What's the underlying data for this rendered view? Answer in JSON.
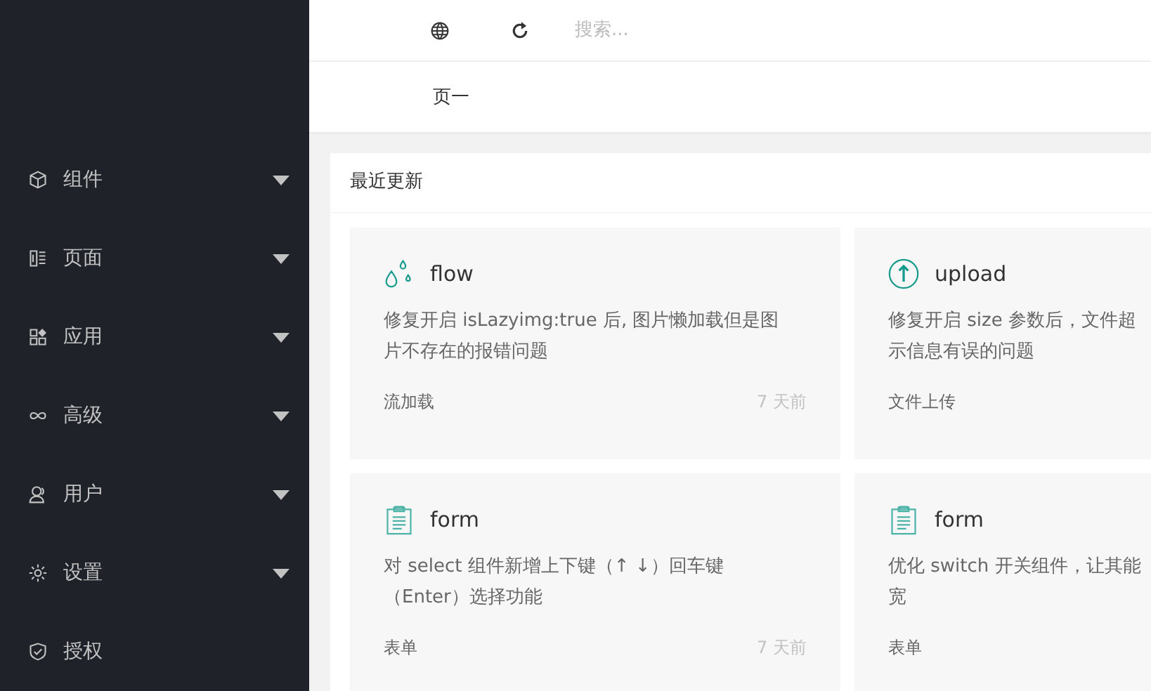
{
  "header": {
    "search": {
      "placeholder": "搜索..."
    }
  },
  "breadcrumb": "页一",
  "sidebar": {
    "items": [
      {
        "label": "组件",
        "expandable": true
      },
      {
        "label": "页面",
        "expandable": true
      },
      {
        "label": "应用",
        "expandable": true
      },
      {
        "label": "高级",
        "expandable": true
      },
      {
        "label": "用户",
        "expandable": true
      },
      {
        "label": "设置",
        "expandable": true
      },
      {
        "label": "授权",
        "expandable": false
      }
    ]
  },
  "panel": {
    "title": "最近更新",
    "cards": [
      {
        "title": "flow",
        "lines": [
          "修复开启 isLazyimg:true 后, 图片懒加载但是图",
          "片不存在的报错问题"
        ],
        "tag": "流加载",
        "time": "7 天前"
      },
      {
        "title": "upload",
        "lines": [
          "修复开启 size 参数后，文件超",
          "示信息有误的问题"
        ],
        "tag": "文件上传"
      },
      {
        "title": "form",
        "lines": [
          "对 select 组件新增上下键（↑ ↓）回车键",
          "（Enter）选择功能"
        ],
        "tag": "表单",
        "time": "7 天前"
      },
      {
        "title": "form",
        "lines": [
          "优化 switch 开关组件，让其能",
          "宽"
        ],
        "tag": "表单"
      }
    ]
  }
}
